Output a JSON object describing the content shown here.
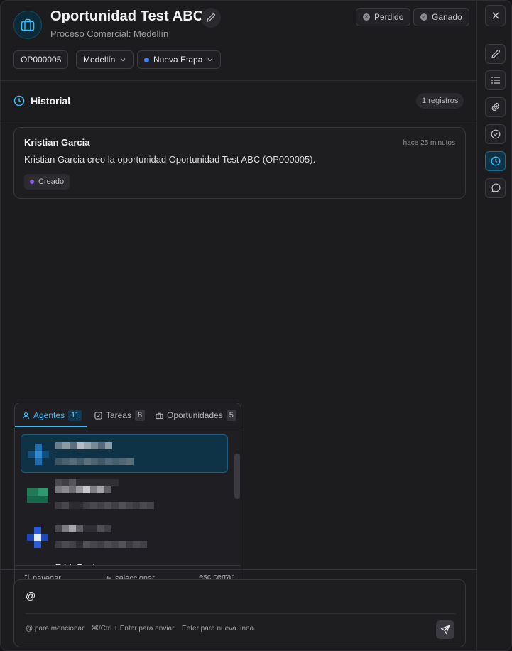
{
  "header": {
    "title": "Oportunidad Test ABC",
    "subtitle": "Proceso Comercial: Medellín",
    "lost_label": "Perdido",
    "won_label": "Ganado",
    "code": "OP000005",
    "city": "Medellín",
    "stage": "Nueva Etapa"
  },
  "history": {
    "title": "Historial",
    "count_label": "1 registros",
    "entries": [
      {
        "author": "Kristian Garcia",
        "time": "hace 25 minutos",
        "text": "Kristian Garcia creo la oportunidad Oportunidad Test ABC (OP000005).",
        "tag": "Creado"
      }
    ]
  },
  "mention_popup": {
    "tabs": [
      {
        "label": "Agentes",
        "count": "11",
        "icon": "user-icon"
      },
      {
        "label": "Tareas",
        "count": "8",
        "icon": "checkbox-icon"
      },
      {
        "label": "Oportunidades",
        "count": "5",
        "icon": "briefcase-icon"
      }
    ],
    "partial_name": "Edd, Gasta",
    "footer": {
      "navigate": "navegar",
      "select": "seleccionar",
      "close": "esc cerrar"
    }
  },
  "composer": {
    "value": "@",
    "hint_mention": "@ para mencionar",
    "hint_send": "⌘/Ctrl + Enter para enviar",
    "hint_newline": "Enter para nueva línea"
  },
  "colors": {
    "accent": "#38bdf8",
    "stage_dot": "#3b82f6",
    "tag_dot": "#8b5cf6"
  }
}
